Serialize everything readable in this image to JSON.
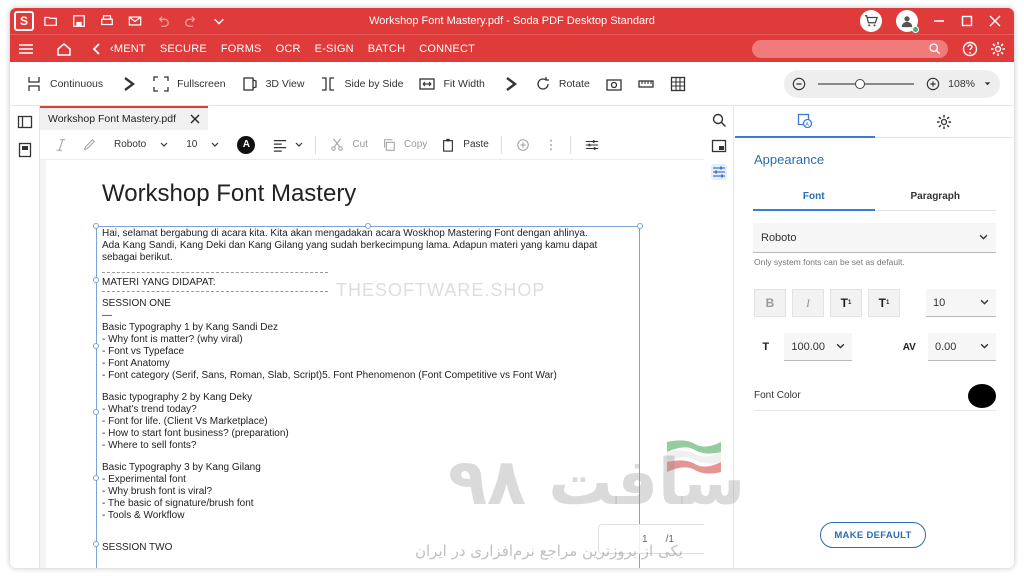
{
  "window": {
    "title": "Workshop Font Mastery.pdf  -  Soda PDF Desktop Standard",
    "logo_letter": "S"
  },
  "menu": {
    "items": [
      "‹MENT",
      "SECURE",
      "FORMS",
      "OCR",
      "E-SIGN",
      "BATCH",
      "CONNECT"
    ]
  },
  "toolbar": {
    "continuous": "Continuous",
    "fullscreen": "Fullscreen",
    "view3d": "3D View",
    "side_by_side": "Side by Side",
    "fit_width": "Fit Width",
    "rotate": "Rotate",
    "zoom_value": "108%"
  },
  "doc_tab": {
    "name": "Workshop Font Mastery.pdf"
  },
  "format_bar": {
    "font": "Roboto",
    "size": "10",
    "color_letter": "A",
    "cut": "Cut",
    "copy": "Copy",
    "paste": "Paste"
  },
  "document": {
    "title": "Workshop Font Mastery",
    "watermark": "THESOFTWARE.SHOP",
    "intro": [
      "Hai, selamat bergabung di acara kita. Kita akan mengadakan acara Woskhop Mastering Font dengan ahlinya.",
      "Ada Kang Sandi, Kang Deki dan Kang Gilang yang sudah berkecimpung lama. Adapun materi yang kamu dapat",
      "sebagai berikut."
    ],
    "materi_heading": "MATERI YANG DIDAPAT:",
    "session_one": "SESSION ONE",
    "session_one_dash": "—",
    "block1": [
      "Basic Typography 1 by Kang Sandi Dez",
      "- Why font is matter? (why viral)",
      "- Font vs Typeface",
      "- Font Anatomy",
      "- Font category (Serif, Sans, Roman, Slab, Script)5. Font Phenomenon (Font Competitive vs Font War)"
    ],
    "block2": [
      "Basic typography 2 by Kang Deky",
      "- What's trend today?",
      "- Font for life. (Client Vs Marketplace)",
      "- How to start font business? (preparation)",
      "- Where to sell fonts?"
    ],
    "block3": [
      "Basic Typography 3 by Kang Gilang",
      "- Experimental font",
      "- Why brush font is viral?",
      "- The basic of signature/brush font",
      "- Tools & Workflow"
    ],
    "session_two": "SESSION TWO",
    "page_nav": {
      "current": "1",
      "total": "/1"
    }
  },
  "props": {
    "heading": "Appearance",
    "tab_font": "Font",
    "tab_paragraph": "Paragraph",
    "font_value": "Roboto",
    "hint": "Only system fonts can be set as default.",
    "bold_label": "B",
    "italic_label": "I",
    "sup_label": "T",
    "sup_mark": "1",
    "sub_label": "T",
    "sub_mark": "1",
    "size_value": "10",
    "scale_icon": "T",
    "scale_value": "100.00",
    "spacing_icon": "AV",
    "spacing_value": "0.00",
    "font_color_label": "Font Color",
    "font_color": "#000000",
    "make_default": "MAKE DEFAULT"
  },
  "overlay_logo": {
    "big_text": "سافت ۹۸",
    "small_text": "یکی از بروزترین مراجع نرم‌افزاری در ایران"
  },
  "colors": {
    "brand_red": "#e03b3b",
    "accent_blue": "#2b6cb0"
  }
}
